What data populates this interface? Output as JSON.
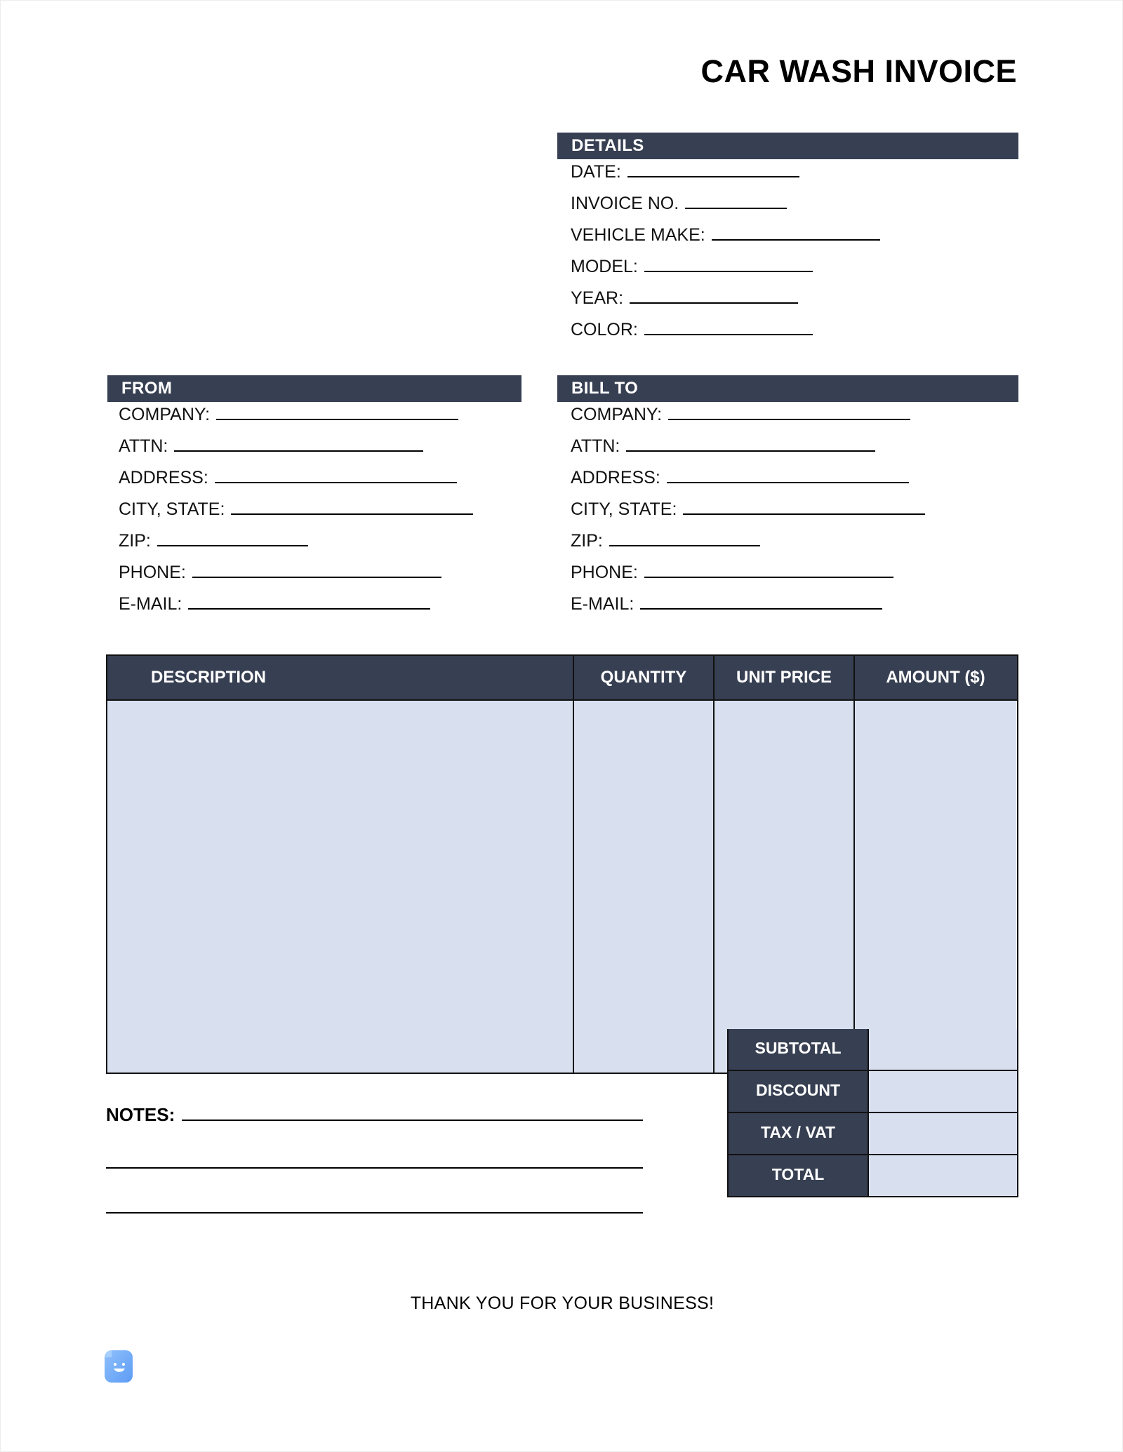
{
  "document": {
    "title": "CAR WASH INVOICE"
  },
  "details": {
    "heading": "DETAILS",
    "fields": [
      {
        "label": "DATE:",
        "value": "",
        "rule_width": 245
      },
      {
        "label": "INVOICE NO.",
        "value": "",
        "rule_width": 145
      },
      {
        "label": "VEHICLE MAKE:",
        "value": "",
        "rule_width": 240
      },
      {
        "label": "MODEL:",
        "value": "",
        "rule_width": 240
      },
      {
        "label": "YEAR:",
        "value": "",
        "rule_width": 240
      },
      {
        "label": "COLOR:",
        "value": "",
        "rule_width": 240
      }
    ]
  },
  "from": {
    "heading": "FROM",
    "fields": [
      {
        "label": "COMPANY:",
        "value": "",
        "rule_width": 345
      },
      {
        "label": "ATTN:",
        "value": "",
        "rule_width": 355
      },
      {
        "label": "ADDRESS:",
        "value": "",
        "rule_width": 345
      },
      {
        "label": "CITY, STATE:",
        "value": "",
        "rule_width": 345
      },
      {
        "label": "ZIP:",
        "value": "",
        "rule_width": 215
      },
      {
        "label": "PHONE:",
        "value": "",
        "rule_width": 355
      },
      {
        "label": "E-MAIL:",
        "value": "",
        "rule_width": 345
      }
    ]
  },
  "bill_to": {
    "heading": "BILL TO",
    "fields": [
      {
        "label": "COMPANY:",
        "value": "",
        "rule_width": 345
      },
      {
        "label": "ATTN:",
        "value": "",
        "rule_width": 355
      },
      {
        "label": "ADDRESS:",
        "value": "",
        "rule_width": 345
      },
      {
        "label": "CITY, STATE:",
        "value": "",
        "rule_width": 345
      },
      {
        "label": "ZIP:",
        "value": "",
        "rule_width": 215
      },
      {
        "label": "PHONE:",
        "value": "",
        "rule_width": 355
      },
      {
        "label": "E-MAIL:",
        "value": "",
        "rule_width": 345
      }
    ]
  },
  "items_table": {
    "columns": [
      "DESCRIPTION",
      "QUANTITY",
      "UNIT PRICE",
      "AMOUNT ($)"
    ],
    "rows": []
  },
  "totals": [
    {
      "label": "SUBTOTAL",
      "value": ""
    },
    {
      "label": "DISCOUNT",
      "value": ""
    },
    {
      "label": "TAX / VAT",
      "value": ""
    },
    {
      "label": "TOTAL",
      "value": ""
    }
  ],
  "notes": {
    "label": "NOTES:",
    "value": "",
    "extra_lines": 2
  },
  "footer": {
    "thank_you": "THANK YOU FOR YOUR BUSINESS!",
    "logo_icon": "document-smile-icon"
  },
  "colors": {
    "header_bar": "#373f52",
    "table_fill": "#d8e0f0",
    "border": "#111111",
    "logo_blue": "#7cb2f7",
    "page_background": "#ffffff"
  }
}
